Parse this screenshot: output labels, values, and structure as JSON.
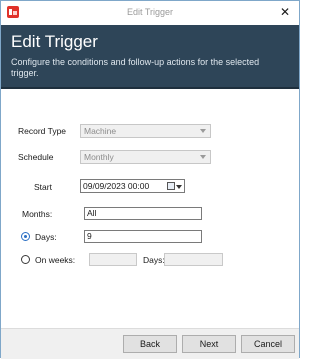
{
  "window": {
    "title": "Edit Trigger",
    "close_glyph": "✕"
  },
  "header": {
    "title": "Edit Trigger",
    "description": "Configure the conditions and follow-up actions for the selected trigger."
  },
  "form": {
    "record_type_label": "Record Type",
    "record_type_value": "Machine",
    "schedule_label": "Schedule",
    "schedule_value": "Monthly",
    "start_label": "Start",
    "start_value": "09/09/2023 00:00",
    "months_label": "Months:",
    "months_value": "All",
    "days_label": "Days:",
    "days_value": "9",
    "days_selected": true,
    "on_weeks_label": "On weeks:",
    "on_weeks_selected": false,
    "weeks_value": "",
    "weeks_days_label": "Days:",
    "weeks_days_value": ""
  },
  "footer": {
    "back_label": "Back",
    "next_label": "Next",
    "cancel_label": "Cancel"
  },
  "icons": {
    "app": "app-logo-icon",
    "close": "close-icon",
    "calendar": "calendar-icon",
    "dropdown": "chevron-down-icon"
  },
  "colors": {
    "header_bg": "#2e4558",
    "accent": "#2b6fc4",
    "app_icon": "#e0322a"
  }
}
